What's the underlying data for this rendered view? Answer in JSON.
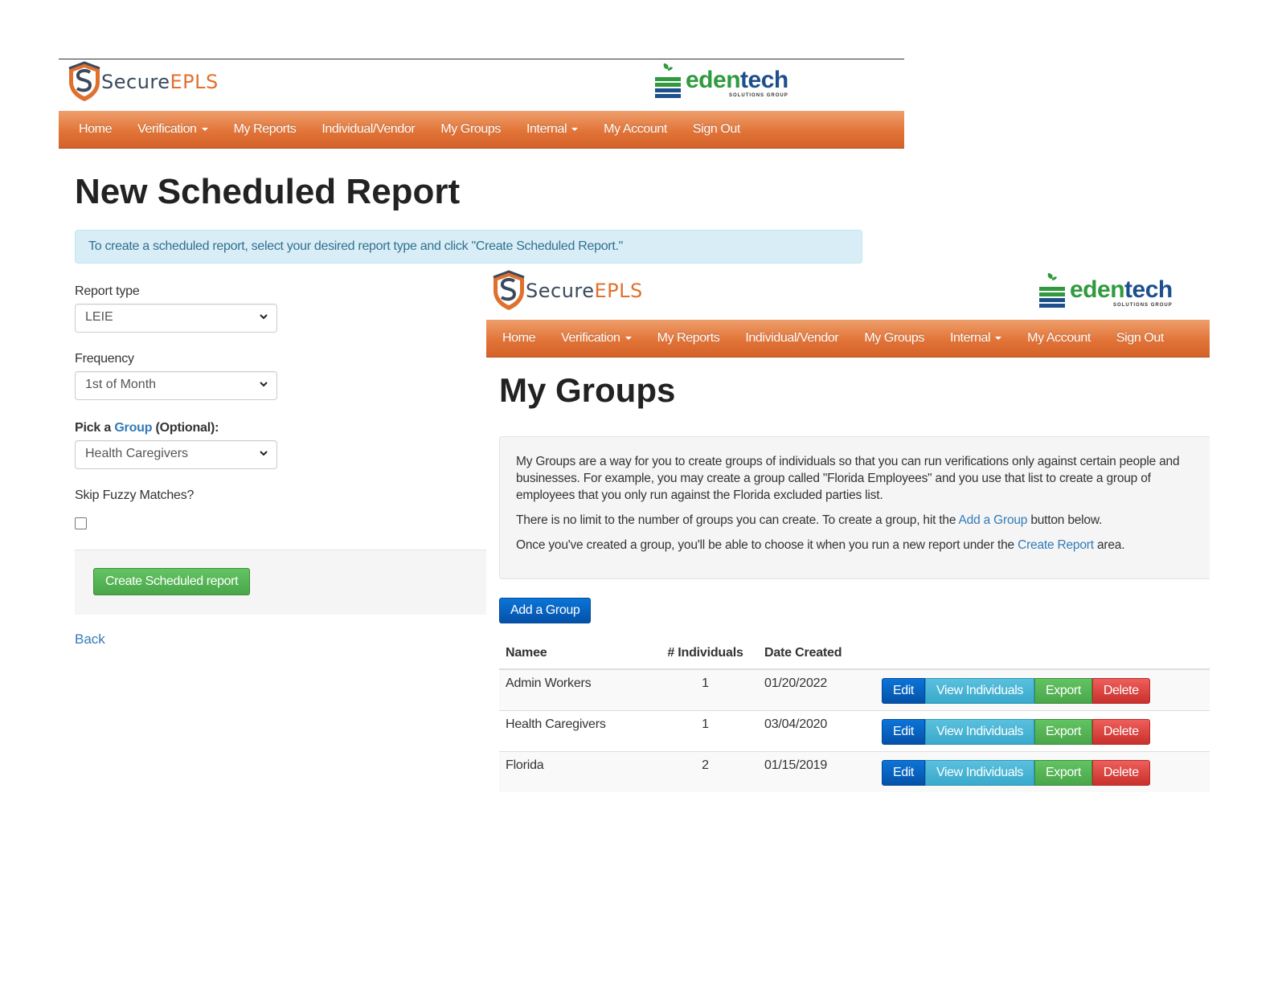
{
  "brand": {
    "secure_part1": "Secure",
    "secure_part2": "EPLS",
    "edentech_part1": "eden",
    "edentech_part2": "tech",
    "edentech_sub": "SOLUTIONS GROUP",
    "colors": {
      "nav_orange": "#e27438",
      "secure_orange": "#e0702e",
      "secure_navy": "#3a4a5c",
      "eden_green": "#2f9a3e",
      "eden_blue": "#1d4f8c"
    }
  },
  "nav": {
    "home": "Home",
    "verification": "Verification",
    "my_reports": "My Reports",
    "individual_vendor": "Individual/Vendor",
    "my_groups": "My Groups",
    "internal": "Internal",
    "my_account": "My Account",
    "sign_out": "Sign Out"
  },
  "scheduled_report": {
    "title": "New Scheduled Report",
    "info": "To create a scheduled report, select your desired report type and click \"Create Scheduled Report.\"",
    "report_type_label": "Report type",
    "report_type_value": "LEIE",
    "frequency_label": "Frequency",
    "frequency_value": "1st of Month",
    "group_label_pre": "Pick a ",
    "group_label_link": "Group",
    "group_label_post": " (Optional):",
    "group_value": "Health Caregivers",
    "skip_fuzzy_label": "Skip Fuzzy Matches?",
    "skip_fuzzy_checked": false,
    "submit_label": "Create Scheduled report",
    "back_label": "Back"
  },
  "my_groups": {
    "title": "My Groups",
    "para1": "My Groups are a way for you to create groups of individuals so that you can run verifications only against certain people and businesses. For example, you may create a group called \"Florida Employees\" and you use that list to create a group of employees that you only run against the Florida excluded parties list.",
    "para2_pre": "There is no limit to the number of groups you can create. To create a group, hit the ",
    "para2_link": "Add a Group",
    "para2_post": " button below.",
    "para3_pre": "Once you've created a group, you'll be able to choose it when you run a new report under the ",
    "para3_link": "Create Report",
    "para3_post": " area.",
    "add_button": "Add a Group",
    "columns": {
      "name": "Namee",
      "individuals": "# Individuals",
      "date": "Date Created"
    },
    "rows": [
      {
        "name": "Admin Workers",
        "individuals": "1",
        "date": "01/20/2022"
      },
      {
        "name": "Health Caregivers",
        "individuals": "1",
        "date": "03/04/2020"
      },
      {
        "name": "Florida",
        "individuals": "2",
        "date": "01/15/2019"
      }
    ],
    "actions": {
      "edit": "Edit",
      "view": "View Individuals",
      "export": "Export",
      "delete": "Delete"
    }
  }
}
